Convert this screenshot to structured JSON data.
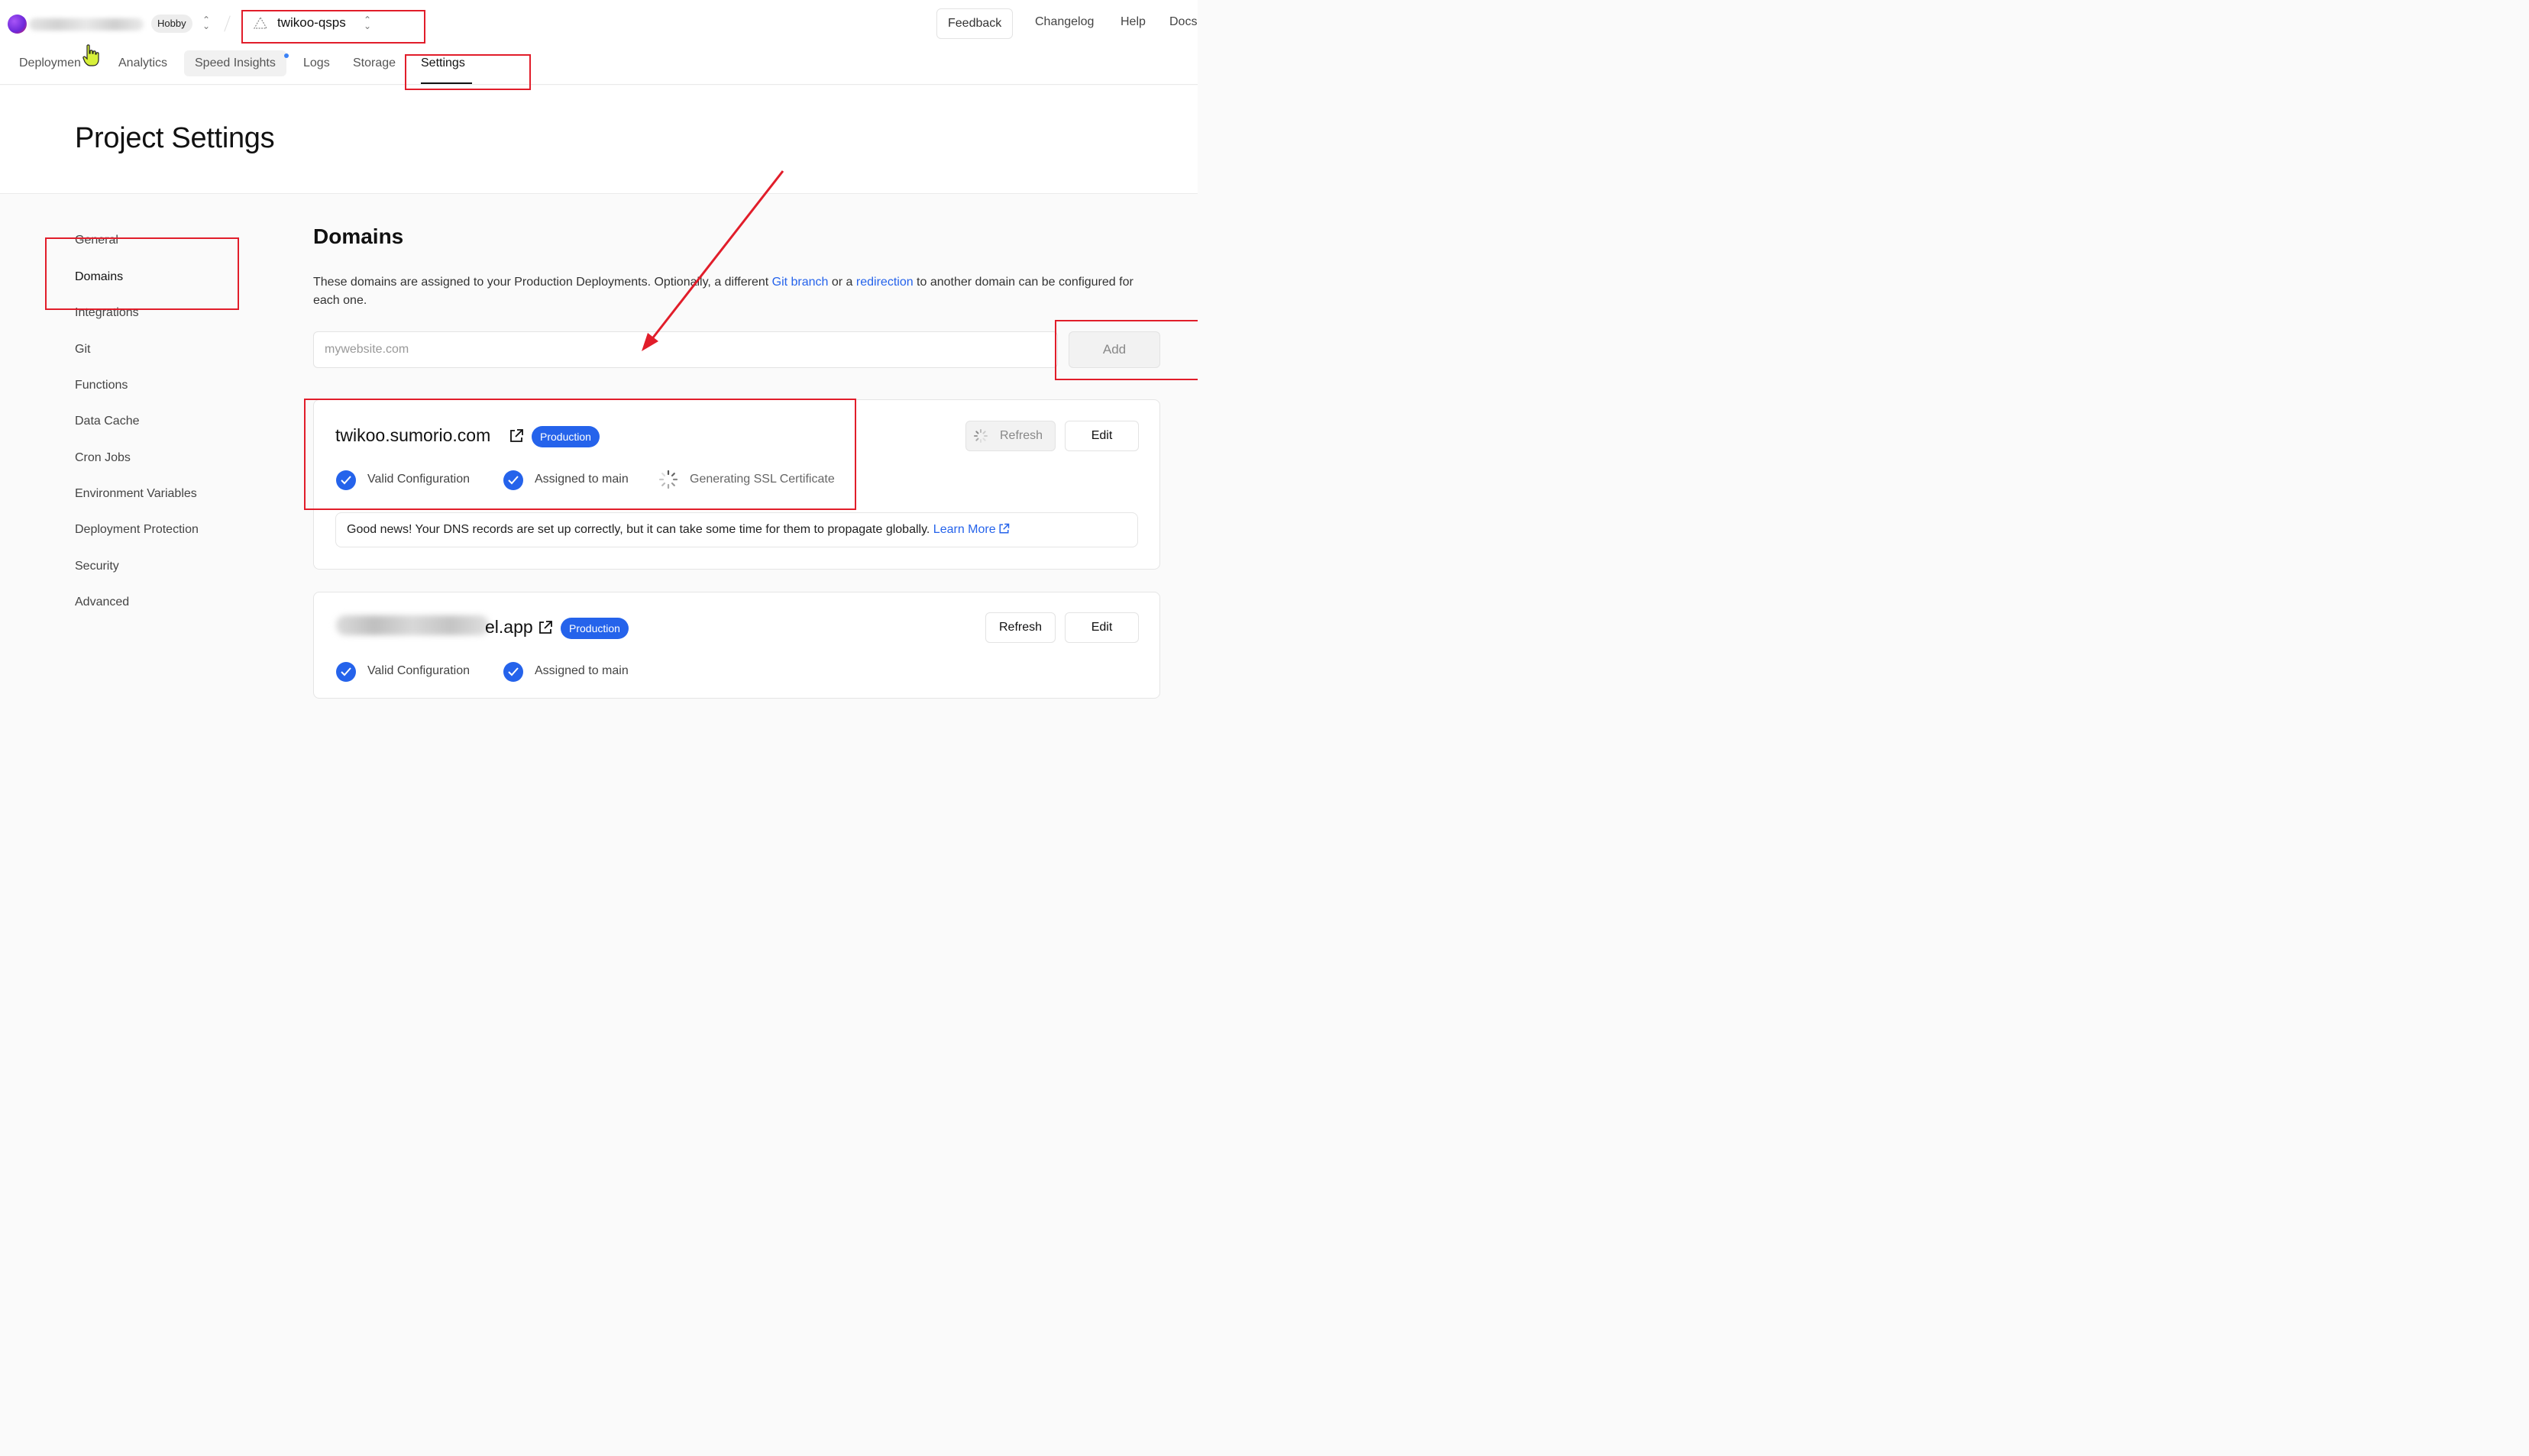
{
  "header": {
    "plan_badge": "Hobby",
    "project_name": "twikoo-qsps",
    "feedback_label": "Feedback",
    "links": [
      "Changelog",
      "Help",
      "Docs"
    ]
  },
  "tabs": [
    "Deploymen",
    "Analytics",
    "Speed Insights",
    "Logs",
    "Storage",
    "Settings"
  ],
  "page_title": "Project Settings",
  "sidebar": [
    "General",
    "Domains",
    "Integrations",
    "Git",
    "Functions",
    "Data Cache",
    "Cron Jobs",
    "Environment Variables",
    "Deployment Protection",
    "Security",
    "Advanced"
  ],
  "domains": {
    "title": "Domains",
    "desc_prefix": "These domains are assigned to your Production Deployments. Optionally, a different ",
    "link_git": "Git branch",
    "desc_mid": " or a ",
    "link_redirect": "redirection",
    "desc_suffix": " to another domain can be configured for each one.",
    "input_placeholder": "mywebsite.com",
    "add_label": "Add",
    "cards": [
      {
        "domain": "twikoo.sumorio.com",
        "badge": "Production",
        "refresh_label": "Refresh",
        "edit_label": "Edit",
        "status1": "Valid Configuration",
        "status2": "Assigned to main",
        "status3": "Generating SSL Certificate",
        "note": "Good news! Your DNS records are set up correctly, but it can take some time for them to propagate globally.",
        "note_link": "Learn More"
      },
      {
        "domain_visible": "el.app",
        "badge": "Production",
        "refresh_label": "Refresh",
        "edit_label": "Edit",
        "status1": "Valid Configuration",
        "status2": "Assigned to main"
      }
    ]
  },
  "colors": {
    "accent": "#2563eb",
    "annotation_red": "#e11d2a"
  }
}
